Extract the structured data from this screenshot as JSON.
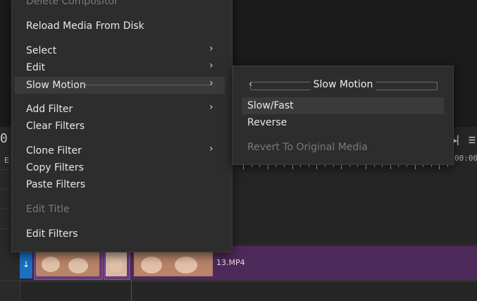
{
  "menu": {
    "items": [
      {
        "label": "Delete Compositor",
        "disabled": true
      },
      {
        "label": "Reload Media From Disk"
      },
      {
        "label": "Select",
        "submenu": true
      },
      {
        "label": "Edit",
        "submenu": true
      },
      {
        "label": "Slow Motion",
        "submenu": true,
        "active": true
      },
      {
        "label": "Add Filter",
        "submenu": true
      },
      {
        "label": "Clear Filters"
      },
      {
        "label": "Clone Filter",
        "submenu": true
      },
      {
        "label": "Copy Filters"
      },
      {
        "label": "Paste Filters"
      },
      {
        "label": "Edit Title",
        "disabled": true
      },
      {
        "label": "Edit Filters"
      }
    ],
    "chevron": "›"
  },
  "submenu": {
    "title": "Slow Motion",
    "back_glyph": "‹",
    "items": [
      {
        "label": "Slow/Fast",
        "highlighted": true
      },
      {
        "label": "Reverse"
      },
      {
        "label": "Revert To Original Media",
        "disabled": true
      }
    ]
  },
  "timeline": {
    "timecode_fragment": "0 S",
    "track_label_fragment": "E",
    "ruler_time": "00:00",
    "clip_name": "13.MP4",
    "track_handle_glyph": "↓"
  },
  "colors": {
    "menu_bg": "#2d2d2d",
    "highlight": "#3a3a3a",
    "track": "#4e2a5a",
    "handle": "#1b6fc4"
  }
}
